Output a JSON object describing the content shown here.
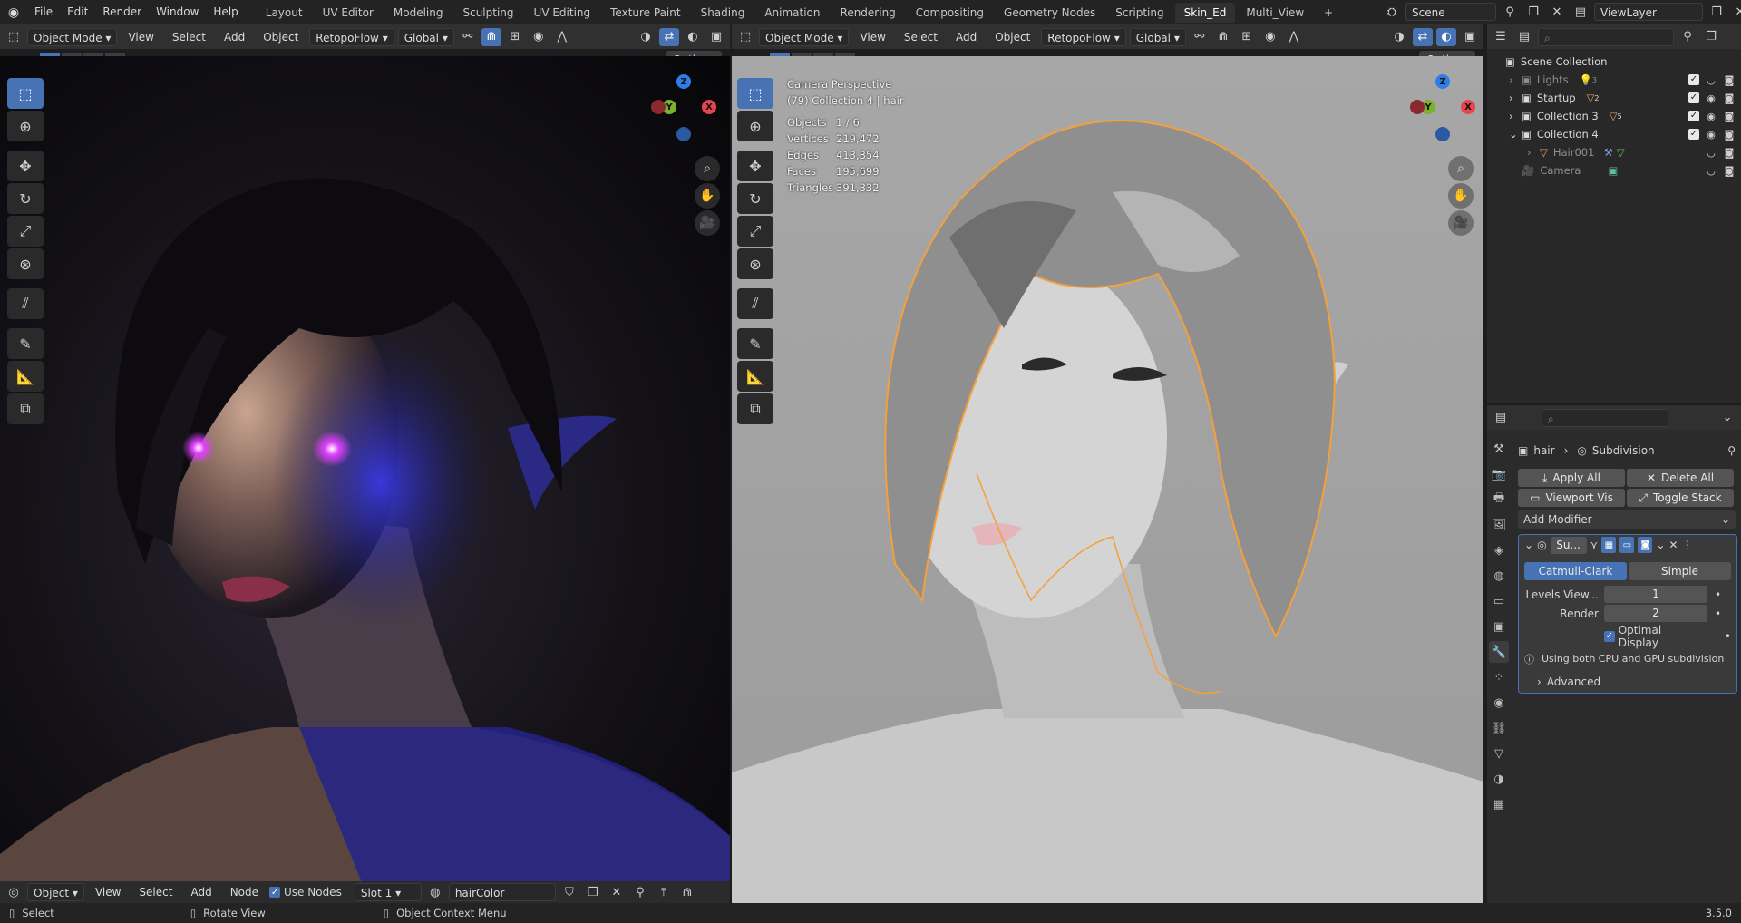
{
  "top_menu": [
    "File",
    "Edit",
    "Render",
    "Window",
    "Help"
  ],
  "workspaces": [
    "Layout",
    "UV Editor",
    "Modeling",
    "Sculpting",
    "UV Editing",
    "Texture Paint",
    "Shading",
    "Animation",
    "Rendering",
    "Compositing",
    "Geometry Nodes",
    "Scripting",
    "Skin_Ed",
    "Multi_View"
  ],
  "active_workspace": "Skin_Ed",
  "scene": "Scene",
  "view_layer": "ViewLayer",
  "left_header": {
    "mode": "Object Mode",
    "menus": [
      "View",
      "Select",
      "Add",
      "Object"
    ],
    "addon": "RetopoFlow",
    "orientation": "Global",
    "options": "Options"
  },
  "right_header": {
    "mode": "Object Mode",
    "menus": [
      "View",
      "Select",
      "Add",
      "Object"
    ],
    "addon": "RetopoFlow",
    "orientation": "Global",
    "options": "Options"
  },
  "camera_info": {
    "title": "Camera Perspective",
    "subtitle": "(79) Collection 4 | hair",
    "objects_label": "Objects",
    "objects": "1 / 6",
    "vertices_label": "Vertices",
    "vertices": "219,472",
    "edges_label": "Edges",
    "edges": "413,354",
    "faces_label": "Faces",
    "faces": "195,699",
    "triangles_label": "Triangles",
    "triangles": "391,332"
  },
  "outliner": {
    "root": "Scene Collection",
    "items": [
      {
        "label": "Lights",
        "badge": "3"
      },
      {
        "label": "Startup",
        "badge": "2"
      },
      {
        "label": "Collection 3",
        "badge": "5"
      },
      {
        "label": "Collection 4"
      },
      {
        "label": "Hair001"
      },
      {
        "label": "Camera"
      }
    ]
  },
  "properties": {
    "breadcrumb_object": "hair",
    "breadcrumb_modifier": "Subdivision",
    "apply_all": "Apply All",
    "delete_all": "Delete All",
    "viewport_vis": "Viewport Vis",
    "toggle_stack": "Toggle Stack",
    "add_modifier": "Add Modifier",
    "modifier_name": "Su...",
    "catmull_clark": "Catmull-Clark",
    "simple": "Simple",
    "levels_label": "Levels View...",
    "levels_value": "1",
    "render_label": "Render",
    "render_value": "2",
    "optimal_display": "Optimal Display",
    "info_text": "Using both CPU and GPU subdivision",
    "advanced": "Advanced"
  },
  "node_header": {
    "object_dd": "Object",
    "menus": [
      "View",
      "Select",
      "Add",
      "Node"
    ],
    "use_nodes": "Use Nodes",
    "slot": "Slot 1",
    "material": "hairColor"
  },
  "status": {
    "select": "Select",
    "rotate": "Rotate View",
    "context": "Object Context Menu",
    "version": "3.5.0"
  },
  "colors": {
    "accent": "#4772b3",
    "selection_outline": "#f5a03a",
    "eye_glow": "#e040ff",
    "rim_light": "#2a2cc9"
  }
}
